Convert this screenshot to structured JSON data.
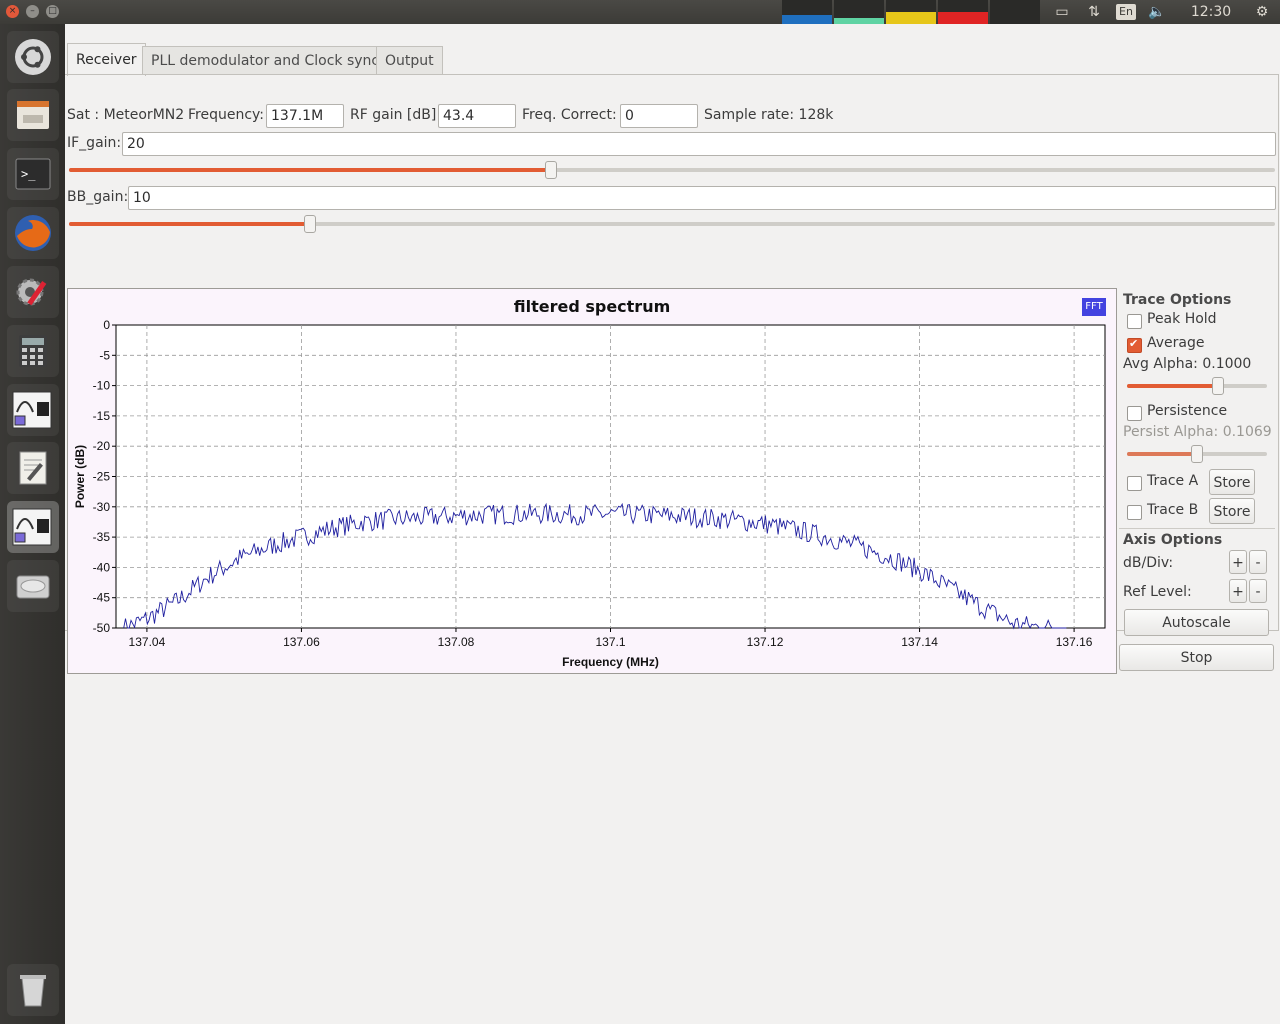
{
  "window": {
    "close_glyph": "×",
    "min_glyph": "–",
    "max_glyph": "□"
  },
  "system": {
    "time": "12:30 AM",
    "lang": "En"
  },
  "tabs": [
    {
      "label": "Receiver",
      "active": true
    },
    {
      "label": "PLL demodulator and Clock sync",
      "active": false
    },
    {
      "label": "Output",
      "active": false
    }
  ],
  "receiver": {
    "sat_label": "Sat : MeteorMN2",
    "freq_label": "Frequency:",
    "freq_value": "137.1M",
    "rf_label": "RF gain [dB]:",
    "rf_value": "43.4",
    "fc_label": "Freq. Correct:",
    "fc_value": "0",
    "sample_rate": "Sample rate: 128k",
    "if_label": "IF_gain:",
    "if_value": "20",
    "if_slider_fraction": 0.4,
    "bb_label": "BB_gain:",
    "bb_value": "10",
    "bb_slider_fraction": 0.2
  },
  "plot_badge": "FFT",
  "trace_options": {
    "title": "Trace Options",
    "peak_hold": "Peak Hold",
    "peak_hold_checked": false,
    "average": "Average",
    "average_checked": true,
    "avg_alpha": "Avg Alpha: 0.1000",
    "avg_alpha_fraction": 0.65,
    "persistence": "Persistence",
    "persistence_checked": false,
    "persist_alpha": "Persist Alpha: 0.1069",
    "persist_alpha_fraction": 0.5,
    "trace_a": "Trace A",
    "trace_b": "Trace B",
    "store_label": "Store"
  },
  "axis_options": {
    "title": "Axis Options",
    "db_div": "dB/Div:",
    "ref_level": "Ref Level:",
    "plus": "+",
    "minus": "-",
    "autoscale": "Autoscale"
  },
  "stop_label": "Stop",
  "chart_data": {
    "type": "line",
    "title": "filtered spectrum",
    "xlabel": "Frequency (MHz)",
    "ylabel": "Power (dB)",
    "xlim": [
      137.036,
      137.164
    ],
    "ylim": [
      -50,
      0
    ],
    "xticks": [
      "137.04",
      "137.06",
      "137.08",
      "137.1",
      "137.12",
      "137.14",
      "137.16"
    ],
    "xtick_values": [
      137.04,
      137.06,
      137.08,
      137.1,
      137.12,
      137.14,
      137.16
    ],
    "yticks": [
      "0",
      "-5",
      "-10",
      "-15",
      "-20",
      "-25",
      "-30",
      "-35",
      "-40",
      "-45",
      "-50"
    ],
    "ytick_values": [
      0,
      -5,
      -10,
      -15,
      -20,
      -25,
      -30,
      -35,
      -40,
      -45,
      -50
    ],
    "grid": true,
    "line_color": "#2020a0",
    "series": [
      {
        "x": [
          137.037,
          137.04,
          137.044,
          137.048,
          137.052,
          137.056,
          137.06,
          137.064,
          137.068,
          137.072,
          137.076,
          137.08,
          137.084,
          137.088,
          137.092,
          137.096,
          137.1,
          137.104,
          137.108,
          137.112,
          137.116,
          137.12,
          137.124,
          137.128,
          137.132,
          137.136,
          137.14,
          137.144,
          137.148,
          137.152,
          137.156,
          137.159
        ],
        "values": [
          -50,
          -48.5,
          -45.5,
          -41.5,
          -38.5,
          -36.5,
          -35,
          -33.5,
          -32.5,
          -32,
          -31.8,
          -31.5,
          -31.3,
          -31.2,
          -31.2,
          -31.3,
          -31.2,
          -31.3,
          -31.5,
          -31.8,
          -32.2,
          -32.8,
          -33.8,
          -35,
          -36.5,
          -38.2,
          -40.5,
          -43.5,
          -46.5,
          -49.2,
          -50,
          -50
        ]
      }
    ]
  }
}
